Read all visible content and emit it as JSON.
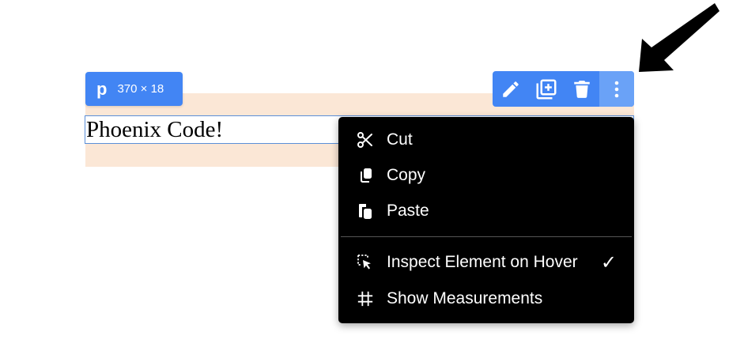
{
  "element": {
    "text": "Phoenix Code!",
    "tag": "p",
    "dimensions": "370 × 18"
  },
  "toolbar": {
    "buttons": [
      {
        "icon": "pencil-icon",
        "action": "edit"
      },
      {
        "icon": "duplicate-icon",
        "action": "duplicate"
      },
      {
        "icon": "trash-icon",
        "action": "delete"
      },
      {
        "icon": "more-vertical-icon",
        "action": "more"
      }
    ],
    "accent_color": "#4285f4",
    "active_color": "#6aa2f7"
  },
  "context_menu": {
    "items": [
      {
        "label": "Cut",
        "icon": "scissors-icon"
      },
      {
        "label": "Copy",
        "icon": "copy-icon"
      },
      {
        "label": "Paste",
        "icon": "paste-icon"
      }
    ],
    "options": [
      {
        "label": "Inspect Element on Hover",
        "icon": "inspect-cursor-icon",
        "checked": true,
        "check_mark": "✓"
      },
      {
        "label": "Show Measurements",
        "icon": "grid-icon",
        "checked": false
      }
    ]
  },
  "annotation": {
    "icon": "pointer-arrow-icon",
    "color": "#000000"
  }
}
